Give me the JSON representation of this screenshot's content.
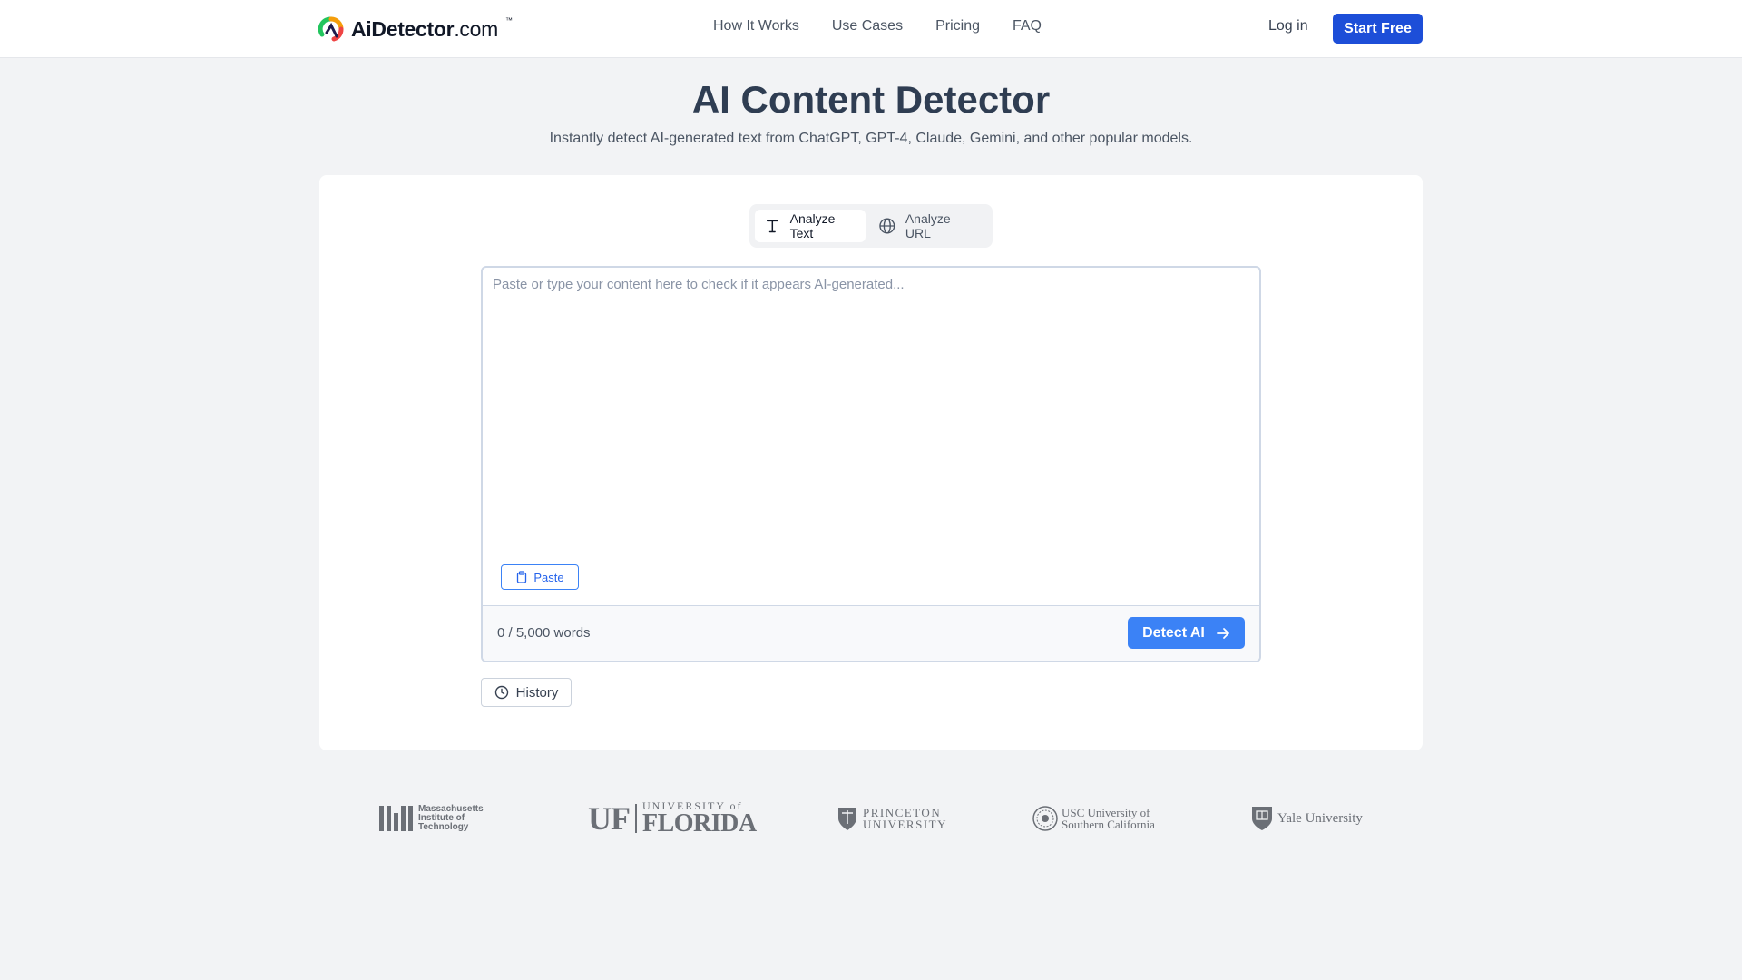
{
  "brand": {
    "name": "AiDetector",
    "suffix": ".com",
    "tm": "™"
  },
  "nav": {
    "items": [
      "How It Works",
      "Use Cases",
      "Pricing",
      "FAQ"
    ]
  },
  "header": {
    "login_label": "Log in",
    "start_label": "Start Free"
  },
  "hero": {
    "title": "AI Content Detector",
    "subtitle": "Instantly detect AI-generated text from ChatGPT, GPT-4, Claude, Gemini, and other popular models."
  },
  "tabs": [
    {
      "label": "Analyze Text",
      "icon": "text-icon",
      "active": true
    },
    {
      "label": "Analyze URL",
      "icon": "globe-icon",
      "active": false
    }
  ],
  "editor": {
    "placeholder": "Paste or type your content here to check if it appears AI-generated...",
    "value": "",
    "paste_label": "Paste",
    "word_count": "0 / 5,000 words",
    "detect_label": "Detect AI"
  },
  "history": {
    "label": "History"
  },
  "universities": {
    "mit": {
      "line1": "Massachusetts",
      "line2": "Institute of",
      "line3": "Technology"
    },
    "uf": {
      "mark": "UF",
      "small": "UNIVERSITY of",
      "name": "FLORIDA"
    },
    "princeton": {
      "line1": "PRINCETON",
      "line2": "UNIVERSITY"
    },
    "usc": {
      "line1": "USC University of",
      "line2": "Southern California"
    },
    "yale": {
      "name": "Yale University"
    }
  },
  "colors": {
    "primary": "#1d4ed8",
    "accent": "#3b82f6",
    "background": "#f2f3f5"
  }
}
